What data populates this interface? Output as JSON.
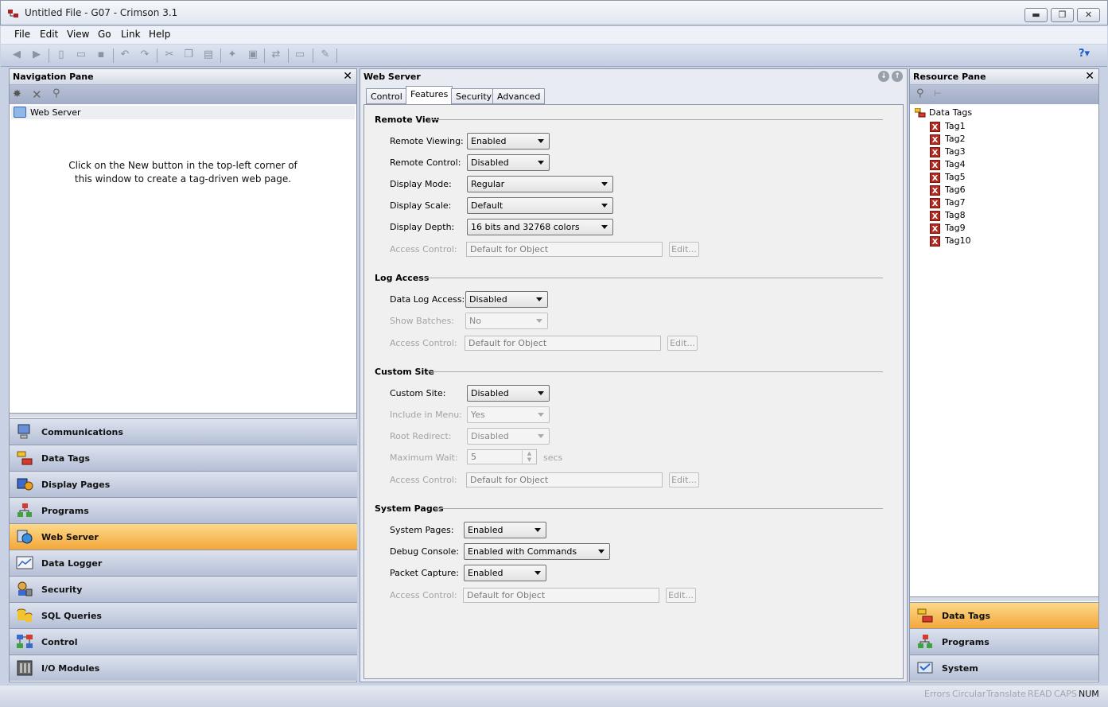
{
  "titlebar": {
    "title": "Untitled File - G07 - Crimson 3.1",
    "minimize": "▬",
    "restore": "❐",
    "close": "✕"
  },
  "menu": {
    "items": [
      "File",
      "Edit",
      "View",
      "Go",
      "Link",
      "Help"
    ]
  },
  "toolbar": {
    "help": "?▾"
  },
  "nav_pane": {
    "title": "Navigation Pane",
    "tree_item": "Web Server",
    "hint_line1": "Click on the New button in the top-left corner of",
    "hint_line2": "this window to create a tag-driven web page.",
    "buttons": [
      "Communications",
      "Data Tags",
      "Display Pages",
      "Programs",
      "Web Server",
      "Data Logger",
      "Security",
      "SQL Queries",
      "Control",
      "I/O Modules"
    ],
    "active": "Web Server"
  },
  "center": {
    "title": "Web Server",
    "tabs": [
      "Control",
      "Features",
      "Security",
      "Advanced"
    ],
    "active_tab": "Features",
    "remote_view": {
      "heading": "Remote View",
      "remote_viewing_label": "Remote Viewing:",
      "remote_viewing": "Enabled",
      "remote_control_label": "Remote Control:",
      "remote_control": "Disabled",
      "display_mode_label": "Display Mode:",
      "display_mode": "Regular",
      "display_scale_label": "Display Scale:",
      "display_scale": "Default",
      "display_depth_label": "Display Depth:",
      "display_depth": "16 bits and 32768 colors",
      "access_label": "Access Control:",
      "access": "Default for Object",
      "edit": "Edit..."
    },
    "log_access": {
      "heading": "Log Access",
      "data_log_label": "Data Log Access:",
      "data_log": "Disabled",
      "show_batches_label": "Show Batches:",
      "show_batches": "No",
      "access_label": "Access Control:",
      "access": "Default for Object",
      "edit": "Edit..."
    },
    "custom_site": {
      "heading": "Custom Site",
      "custom_site_label": "Custom Site:",
      "custom_site": "Disabled",
      "include_menu_label": "Include in Menu:",
      "include_menu": "Yes",
      "root_redirect_label": "Root Redirect:",
      "root_redirect": "Disabled",
      "max_wait_label": "Maximum Wait:",
      "max_wait": "5",
      "max_wait_unit": "secs",
      "access_label": "Access Control:",
      "access": "Default for Object",
      "edit": "Edit..."
    },
    "system_pages": {
      "heading": "System Pages",
      "system_pages_label": "System Pages:",
      "system_pages": "Enabled",
      "debug_label": "Debug Console:",
      "debug": "Enabled with Commands",
      "packet_label": "Packet Capture:",
      "packet": "Enabled",
      "access_label": "Access Control:",
      "access": "Default for Object",
      "edit": "Edit..."
    }
  },
  "resource_pane": {
    "title": "Resource Pane",
    "root": "Data Tags",
    "tags": [
      "Tag1",
      "Tag2",
      "Tag3",
      "Tag4",
      "Tag5",
      "Tag6",
      "Tag7",
      "Tag8",
      "Tag9",
      "Tag10"
    ],
    "buttons": [
      "Data Tags",
      "Programs",
      "System"
    ],
    "active": "Data Tags"
  },
  "statusbar": {
    "items": [
      "Errors",
      "Circular",
      "Translate",
      "READ",
      "CAPS",
      "NUM"
    ]
  },
  "colors": {
    "accent_active": "#f3a73a",
    "tag_icon": "#b42a22"
  }
}
